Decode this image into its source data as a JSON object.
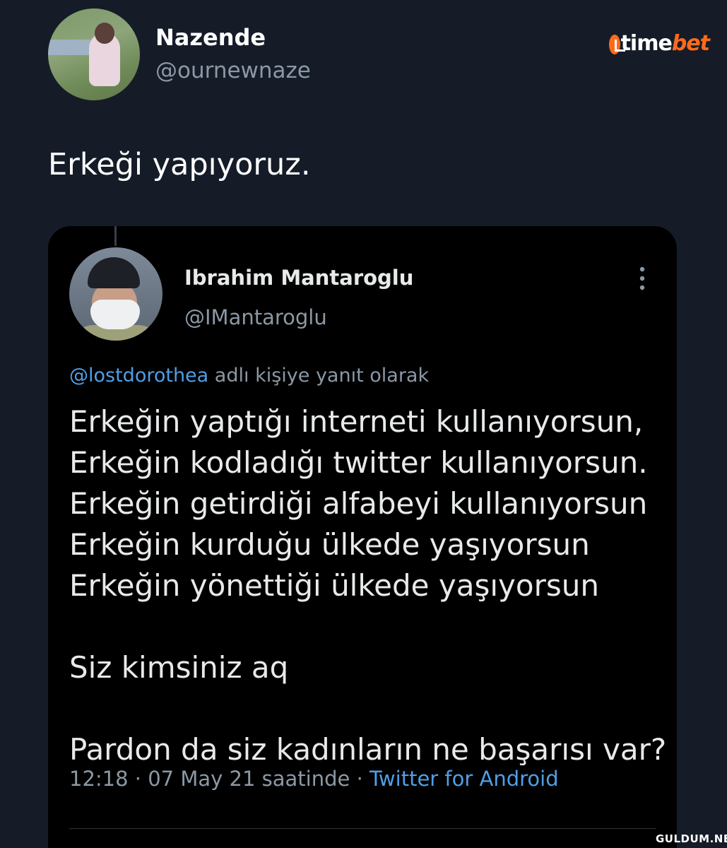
{
  "tweet": {
    "author_name": "Nazende",
    "author_handle": "@ournewnaze",
    "text": "Erkeği yapıyoruz."
  },
  "brand": {
    "time": "time",
    "bet": "bet",
    "accent": "#ff6a1a"
  },
  "quoted_tweet": {
    "author_name": "Ibrahim Mantaroglu",
    "author_handle": "@IMantaroglu",
    "reply_mention": "@lostdorothea",
    "reply_suffix": " adlı kişiye yanıt olarak",
    "lines": [
      "Erkeğin yaptığı interneti kullanıyorsun,",
      "Erkeğin kodladığı twitter kullanıyorsun.",
      "Erkeğin getirdiği alfabeyi kullanıyorsun",
      "Erkeğin kurduğu ülkede yaşıyorsun",
      "Erkeğin yönettiği ülkede yaşıyorsun"
    ],
    "line_2": "Siz kimsiniz aq",
    "line_3": "Pardon da siz kadınların ne başarısı var?",
    "timestamp": "12:18 · 07 May 21 saatinde · ",
    "source": "Twitter for Android",
    "link_color": "#4f9fe6"
  },
  "watermark": "GULDUM.NET",
  "icons": [
    "more-vertical-icon",
    "timebet-logo"
  ]
}
